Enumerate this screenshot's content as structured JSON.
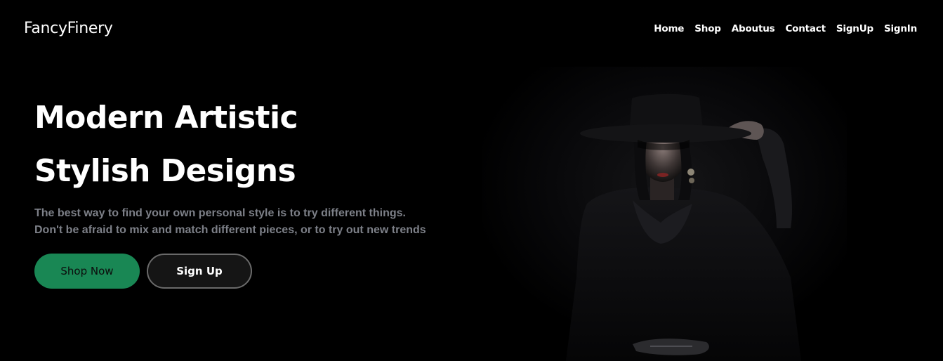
{
  "brand": "FancyFinery",
  "nav": {
    "items": [
      "Home",
      "Shop",
      "Aboutus",
      "Contact",
      "SignUp",
      "SignIn"
    ]
  },
  "hero": {
    "title_line1": "Modern Artistic",
    "title_line2": "Stylish Designs",
    "desc_line1": "The best way to find your own personal style is to try different things.",
    "desc_line2": "Don't be afraid to mix and match different pieces, or to try out new trends",
    "shop_button": "Shop Now",
    "signup_button": "Sign Up",
    "image_subject": "woman-in-black-hat-photo"
  },
  "colors": {
    "background": "#000000",
    "accent": "#198754",
    "muted_text": "#7d8088",
    "button_border": "#6a6a6a"
  }
}
